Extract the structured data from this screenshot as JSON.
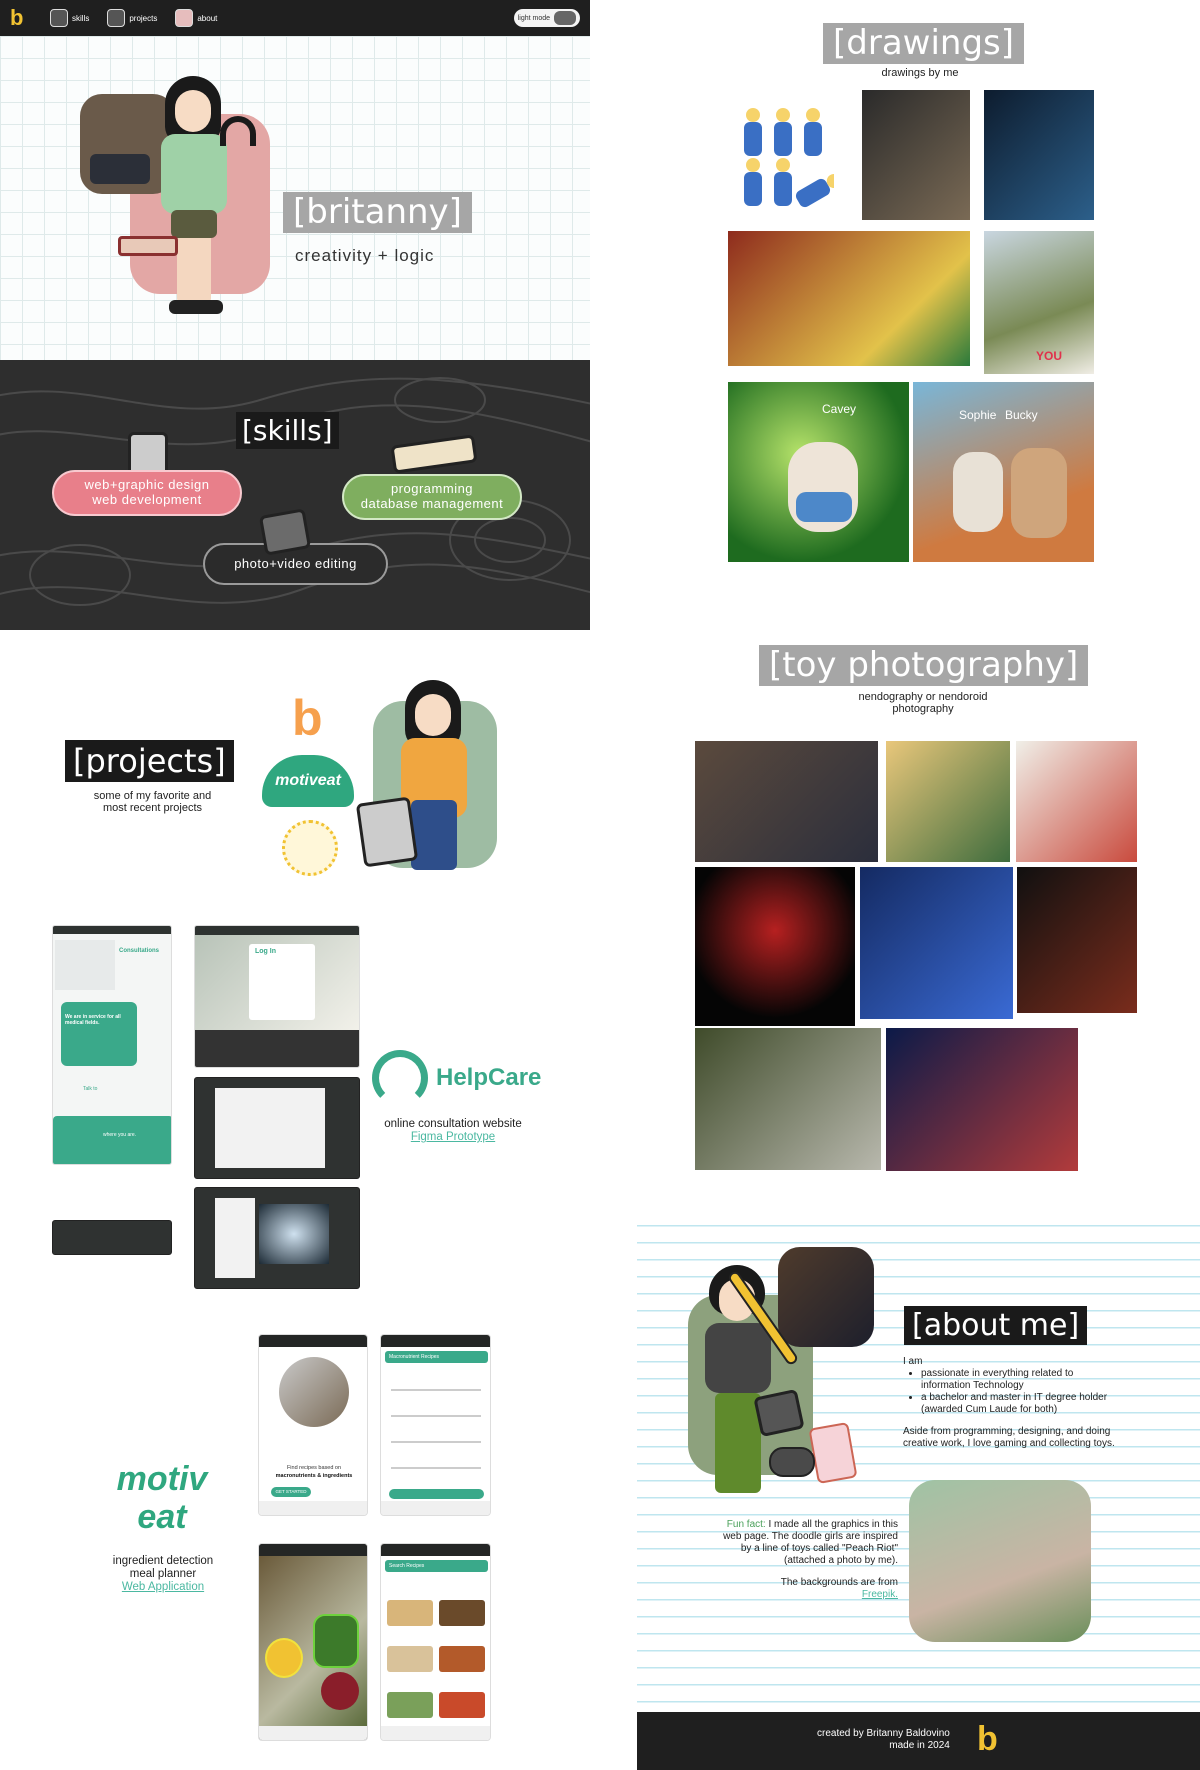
{
  "nav": {
    "logo": "b",
    "items": [
      {
        "label": "skills",
        "icon": "doodle-girl-icon"
      },
      {
        "label": "projects",
        "icon": "gameboy-icon"
      },
      {
        "label": "about",
        "icon": "figure-box-icon"
      }
    ],
    "toggle_label": "light mode",
    "toggle_icon": "gamepad-icon"
  },
  "hero": {
    "title": "[britanny]",
    "tagline": "creativity + logic"
  },
  "skills": {
    "title": "[skills]",
    "pill1": {
      "line1": "web+graphic design",
      "line2": "web development"
    },
    "pill2": {
      "line1": "programming",
      "line2": "database management"
    },
    "pill3": {
      "line1": "photo+video editing"
    }
  },
  "drawings": {
    "title": "[drawings]",
    "subtitle": "drawings by me",
    "labels": {
      "cavey": "Cavey",
      "sophie": "Sophie",
      "bucky": "Bucky",
      "you": "YOU"
    }
  },
  "toy": {
    "title": "[toy photography]",
    "subtitle_line1": "nendography or nendoroid",
    "subtitle_line2": "photography"
  },
  "projects": {
    "title": "[projects]",
    "subtitle_line1": "some of my favorite and",
    "subtitle_line2": "most recent projects",
    "logo_motiveat": "motiveat"
  },
  "helpcare": {
    "brand": "HelpCare",
    "description": "online consultation website",
    "link": "Figma Prototype",
    "shots": {
      "consultations": "Consultations",
      "medical_fields": "We are in service for all medical fields.",
      "talk_to": "Talk to",
      "where_you_are": "where you are.",
      "login": "Log In"
    }
  },
  "motiveat": {
    "brand_line1": "motiv",
    "brand_line2": "eat",
    "desc_line1": "ingredient detection",
    "desc_line2": "meal planner",
    "link": "Web Application",
    "phone_text": "Find recipes based on",
    "phone_text_bold": "macronutrients & ingredients",
    "get_started": "GET STARTED",
    "recipes_title": "Macronutrient Recipes",
    "search_title": "Search Recipes"
  },
  "about": {
    "title": "[about me]",
    "intro": "I am",
    "bullets": [
      "passionate in everything related to information Technology",
      "a bachelor and master in IT degree holder (awarded Cum Laude for both)"
    ],
    "para": "Aside from programming, designing, and doing creative work, I love gaming and collecting toys.",
    "funfact_label": "Fun fact:",
    "funfact": " I made all the graphics in this web page. The doodle girls are inspired by a line of toys called \"Peach Riot\" (attached a photo by me).",
    "backgrounds": "The backgrounds are from",
    "freepik": "Freepik."
  },
  "footer": {
    "line1": "created by Britanny Baldovino",
    "line2": "made in 2024",
    "logo": "b"
  },
  "colors": {
    "dark": "#1f1f1f",
    "pink": "#e87f8a",
    "green": "#7fae5f",
    "teal": "#3aa98a",
    "gray_title": "#a6a6a6"
  }
}
